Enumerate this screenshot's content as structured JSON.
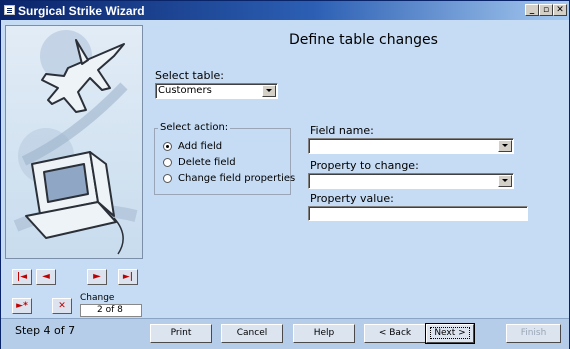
{
  "window": {
    "title": "Surgical Strike Wizard",
    "minimize": "_",
    "restore": "▫",
    "close": "✕"
  },
  "main": {
    "heading": "Define table changes",
    "select_table": {
      "label": "Select table:",
      "value": "Customers"
    },
    "action_group": {
      "title": "Select action:",
      "options": [
        {
          "label": "Add field",
          "selected": true
        },
        {
          "label": "Delete field",
          "selected": false
        },
        {
          "label": "Change field properties",
          "selected": false
        }
      ]
    },
    "field_name": {
      "label": "Field name:",
      "value": ""
    },
    "property_to_change": {
      "label": "Property to change:",
      "value": ""
    },
    "property_value": {
      "label": "Property value:",
      "value": ""
    }
  },
  "nav": {
    "first": "|◄",
    "prev": "◄",
    "next": "►",
    "last": "►|",
    "new": "►*",
    "delete": "✕",
    "change_label": "Change",
    "record_position": "2 of 8"
  },
  "footer": {
    "step": "Step 4 of 7",
    "buttons": {
      "print": "Print",
      "cancel": "Cancel",
      "help": "Help",
      "back": "< Back",
      "next": "Next >",
      "finish": "Finish"
    }
  },
  "colors": {
    "background": "#c6dcf4",
    "titlebar": "#0a246a",
    "nav_arrows": "#c00000"
  }
}
